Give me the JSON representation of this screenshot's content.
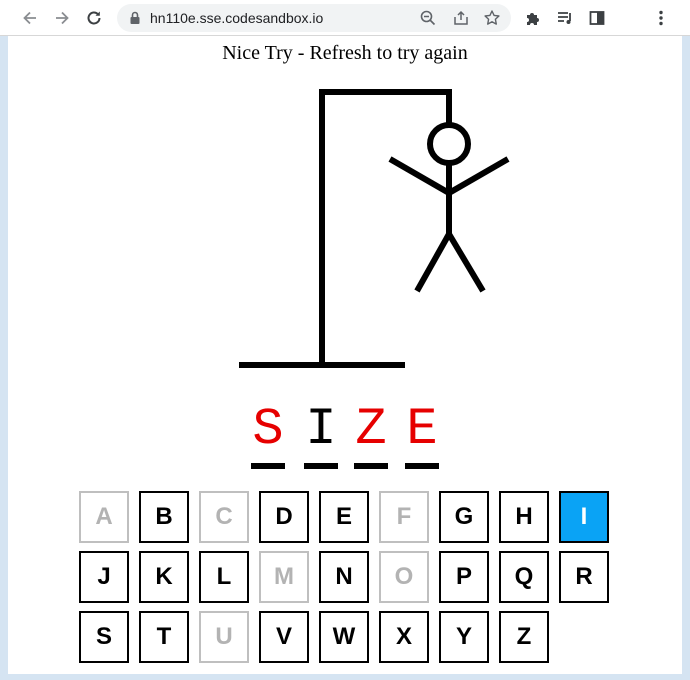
{
  "browser": {
    "url": "hn110e.sse.codesandbox.io",
    "icons": [
      "back-arrow-icon",
      "forward-arrow-icon",
      "reload-icon",
      "lock-icon",
      "zoom-out-icon",
      "share-icon",
      "star-icon",
      "extensions-puzzle-icon",
      "media-playlist-icon",
      "side-panel-icon",
      "kebab-menu-icon"
    ]
  },
  "game": {
    "status_message": "Nice Try - Refresh to try again",
    "word_slots": [
      {
        "letter": "S",
        "color": "#e60000"
      },
      {
        "letter": "I",
        "color": "#000000"
      },
      {
        "letter": "Z",
        "color": "#e60000"
      },
      {
        "letter": "E",
        "color": "#e60000"
      }
    ],
    "keyboard_rows": [
      [
        {
          "letter": "A",
          "state": "used"
        },
        {
          "letter": "B",
          "state": "available"
        },
        {
          "letter": "C",
          "state": "used"
        },
        {
          "letter": "D",
          "state": "available"
        },
        {
          "letter": "E",
          "state": "available"
        },
        {
          "letter": "F",
          "state": "used"
        },
        {
          "letter": "G",
          "state": "available"
        },
        {
          "letter": "H",
          "state": "available"
        },
        {
          "letter": "I",
          "state": "active"
        }
      ],
      [
        {
          "letter": "J",
          "state": "available"
        },
        {
          "letter": "K",
          "state": "available"
        },
        {
          "letter": "L",
          "state": "available"
        },
        {
          "letter": "M",
          "state": "used"
        },
        {
          "letter": "N",
          "state": "available"
        },
        {
          "letter": "O",
          "state": "used"
        },
        {
          "letter": "P",
          "state": "available"
        },
        {
          "letter": "Q",
          "state": "available"
        },
        {
          "letter": "R",
          "state": "available"
        }
      ],
      [
        {
          "letter": "S",
          "state": "available"
        },
        {
          "letter": "T",
          "state": "available"
        },
        {
          "letter": "U",
          "state": "used"
        },
        {
          "letter": "V",
          "state": "available"
        },
        {
          "letter": "W",
          "state": "available"
        },
        {
          "letter": "X",
          "state": "available"
        },
        {
          "letter": "Y",
          "state": "available"
        },
        {
          "letter": "Z",
          "state": "available"
        }
      ]
    ],
    "colors": {
      "revealed_letter": "#000000",
      "missed_letter": "#e60000",
      "active_key": "#0aa3f5",
      "used_key_text": "#b3b3b3"
    }
  }
}
